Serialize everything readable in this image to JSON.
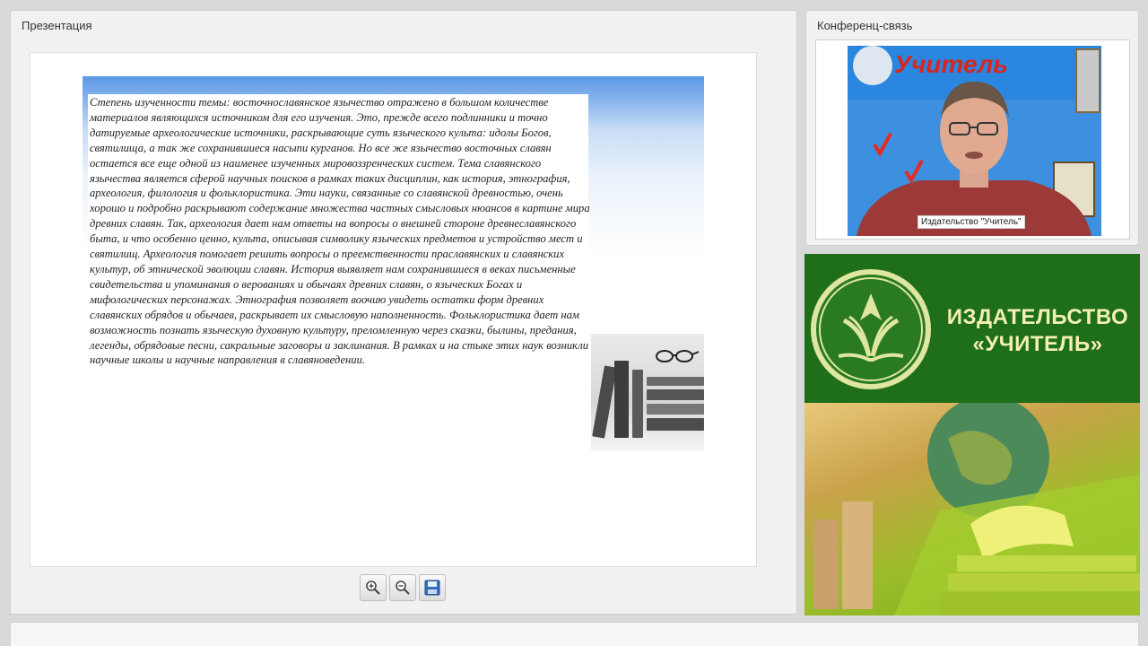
{
  "presentation": {
    "title": "Презентация",
    "slide_text": "Степень изученности темы: восточнославянское язычество отражено в большом количестве материалов являющихся источником для его изучения. Это, прежде всего подлинники и точно датируемые археологические источники, раскрывающие суть языческого культа: идолы Богов, святилища, а так же сохранившиеся насыпи курганов. Но все же язычество восточных славян остается все еще одной из наименее изученных мировоззренческих систем. Тема славянского язычества является сферой научных поисков в рамках таких дисциплин, как история, этнография, археология, филология и фольклористика. Эти науки, связанные со славянской древностью, очень хорошо и подробно раскрывают содержание множества частных смысловых нюансов в картине мира древних славян. Так, археология дает нам ответы на вопросы о внешней стороне древнеславянского быта, и что особенно ценно, культа, описывая символику языческих предметов и устройство мест и святилищ. Археология помогает решить вопросы о преемственности праславянских и славянских культур, об этнической эволюции славян. История выявляет нам сохранившиеся в веках письменные свидетельства и упоминания о верованиях и обычаях древних славян, о языческих Богах и мифологических персонажах. Этнография позволяет воочию увидеть остатки форм древних славянских обрядов и обычаев, раскрывает их смысловую наполненность. Фольклористика дает нам возможность познать языческую духовную культуру, преломленную через сказки, былины, предания, легенды, обрядовые песни, сакральные заговоры и заклинания. В рамках и на стыке этих наук возникли научные школы и научные направления в славяноведении.",
    "tools": [
      {
        "name": "zoom-in-icon"
      },
      {
        "name": "zoom-out-icon"
      },
      {
        "name": "save-icon"
      }
    ]
  },
  "conference": {
    "title": "Конференц-связь",
    "participant_name": "Издательство \"Учитель\""
  },
  "banner": {
    "line1": "ИЗДАТЕЛЬСТВО",
    "line2": "«УЧИТЕЛЬ»",
    "brand_green": "#1e6e1a",
    "text_color": "#f4f0b0"
  }
}
